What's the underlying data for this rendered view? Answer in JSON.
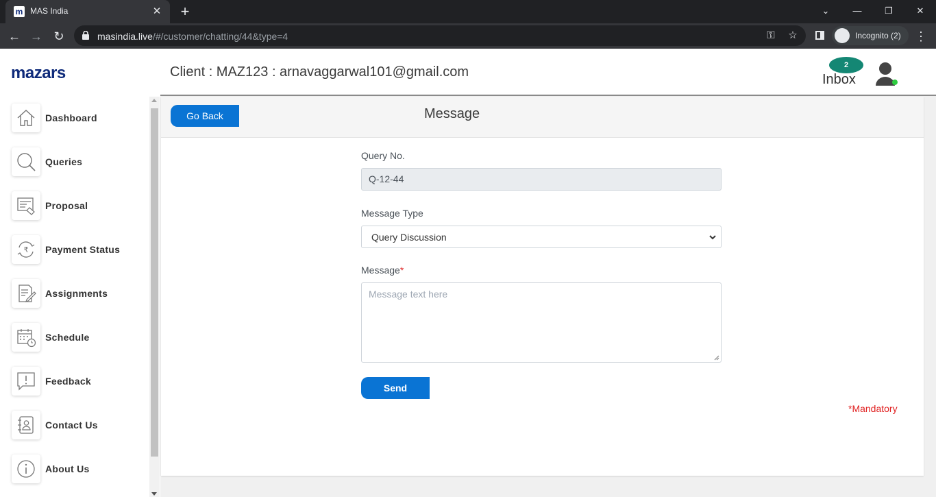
{
  "browser": {
    "tab_title": "MAS India",
    "favicon_letter": "m",
    "url_domain": "masindia.live",
    "url_path": "/#/customer/chatting/44&type=4",
    "incognito_label": "Incognito (2)"
  },
  "sidebar": {
    "logo": "mazars",
    "items": [
      {
        "label": "Dashboard",
        "icon": "home-icon"
      },
      {
        "label": "Queries",
        "icon": "search-icon"
      },
      {
        "label": "Proposal",
        "icon": "proposal-icon"
      },
      {
        "label": "Payment Status",
        "icon": "rupee-refresh-icon"
      },
      {
        "label": "Assignments",
        "icon": "document-edit-icon"
      },
      {
        "label": "Schedule",
        "icon": "calendar-clock-icon"
      },
      {
        "label": "Feedback",
        "icon": "feedback-icon"
      },
      {
        "label": "Contact Us",
        "icon": "contact-book-icon"
      },
      {
        "label": "About Us",
        "icon": "info-icon"
      }
    ]
  },
  "header": {
    "client_title": "Client : MAZ123 : arnavaggarwal101@gmail.com",
    "inbox_count": "2",
    "inbox_label": "Inbox"
  },
  "card": {
    "go_back_label": "Go Back",
    "title": "Message"
  },
  "form": {
    "query_no_label": "Query No.",
    "query_no_value": "Q-12-44",
    "message_type_label": "Message Type",
    "message_type_value": "Query Discussion",
    "message_label": "Message",
    "required_mark": "*",
    "message_placeholder": "Message text here",
    "send_label": "Send",
    "mandatory_note": "*Mandatory"
  },
  "colors": {
    "primary_button": "#0a74d4",
    "inbox_badge": "#148774",
    "logo": "#0e2a7a",
    "mandatory": "#e02020",
    "online_status": "#2ecc40"
  }
}
